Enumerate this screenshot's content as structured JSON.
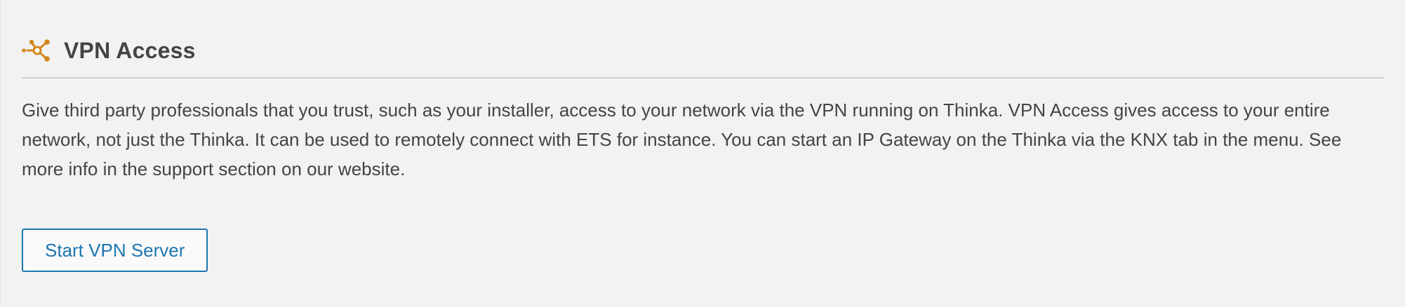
{
  "section": {
    "icon": "vpn-network-icon",
    "title": "VPN Access",
    "description": "Give third party professionals that you trust, such as your installer, access to your network via the VPN running on Thinka. VPN Access gives access to your entire network, not just the Thinka. It can be used to remotely connect with ETS for instance. You can start an IP Gateway on the Thinka via the KNX tab in the menu. See more info in the support section on our website.",
    "button_label": "Start VPN Server"
  },
  "colors": {
    "accent_icon": "#d4861c",
    "button_border": "#1d76b0",
    "background": "#f2f2f2",
    "text": "#444444"
  }
}
